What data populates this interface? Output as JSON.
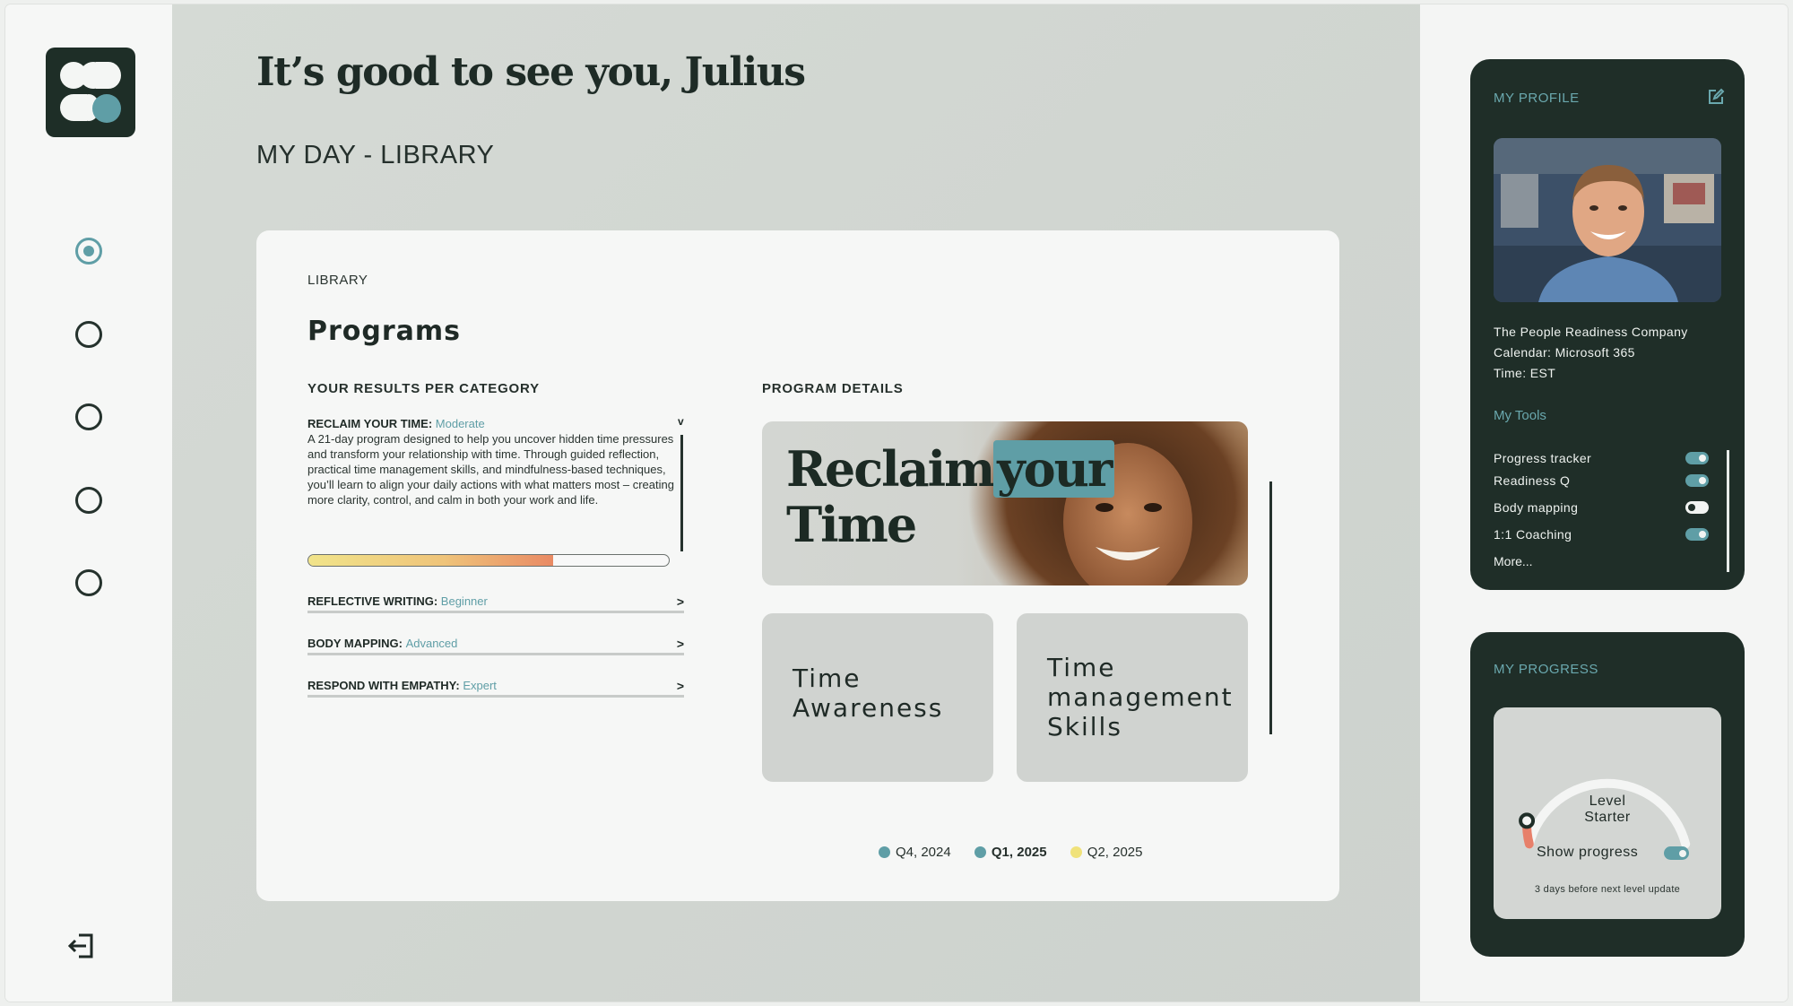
{
  "header": {
    "greeting": "It’s good to see you, Julius",
    "subtitle": "MY DAY - LIBRARY"
  },
  "colors": {
    "accent": "#5f9ea6",
    "dark": "#1f2e28",
    "q4_2024": "#5f9ea6",
    "q1_2025": "#5f9ea6",
    "q2_2025": "#f0e27a"
  },
  "sidebar": {
    "logo": "brand-logo",
    "items": [
      {
        "name": "nav-home",
        "active": true
      },
      {
        "name": "nav-item-2",
        "active": false
      },
      {
        "name": "nav-item-3",
        "active": false
      },
      {
        "name": "nav-item-4",
        "active": false
      },
      {
        "name": "nav-item-5",
        "active": false
      }
    ],
    "logout_icon": "logout-icon"
  },
  "library": {
    "label": "LIBRARY",
    "title": "Programs",
    "results_heading": "YOUR RESULTS PER CATEGORY",
    "details_heading": "PROGRAM DETAILS",
    "main_category": {
      "name": "RECLAIM YOUR TIME:",
      "level": "Moderate",
      "description": "A 21-day program designed to help you uncover hidden time pressures and transform your relationship with time. Through guided reflection, practical time management skills, and mindfulness-based techniques, you’ll learn to align your daily actions with what matters most – creating more clarity, control, and calm in both your work and life.",
      "progress": 0.68,
      "chevron": "v"
    },
    "categories": [
      {
        "name": "REFLECTIVE WRITING:",
        "level": "Beginner",
        "chevron": ">"
      },
      {
        "name": "BODY MAPPING:",
        "level": "Advanced",
        "chevron": ">"
      },
      {
        "name": "RESPOND WITH EMPATHY:",
        "level": "Expert",
        "chevron": ">"
      }
    ],
    "hero": {
      "line1a": "Reclaim",
      "line1b": "your",
      "line2": "Time"
    },
    "tiles": [
      {
        "title": "Time Awareness"
      },
      {
        "title": "Time management Skills"
      }
    ],
    "legend": [
      {
        "label": "Q4, 2024",
        "color": "#5f9ea6",
        "selected": false
      },
      {
        "label": "Q1, 2025",
        "color": "#5f9ea6",
        "selected": true
      },
      {
        "label": "Q2, 2025",
        "color": "#f0e27a",
        "selected": false
      }
    ]
  },
  "profile": {
    "title": "MY PROFILE",
    "edit_icon": "edit-icon",
    "company": "The People Readiness Company",
    "calendar": "Calendar: Microsoft 365",
    "time": "Time: EST",
    "tools_heading": "My Tools",
    "tools": [
      {
        "label": "Progress tracker",
        "on": true
      },
      {
        "label": "Readiness Q",
        "on": true
      },
      {
        "label": "Body mapping",
        "on": false
      },
      {
        "label": "1:1 Coaching",
        "on": true
      }
    ],
    "more": "More..."
  },
  "progress": {
    "title": "MY PROGRESS",
    "level_label": "Level",
    "level_value": "Starter",
    "level_fraction": 0.08,
    "show_progress": "Show progress",
    "note": "3 days before next level update"
  }
}
